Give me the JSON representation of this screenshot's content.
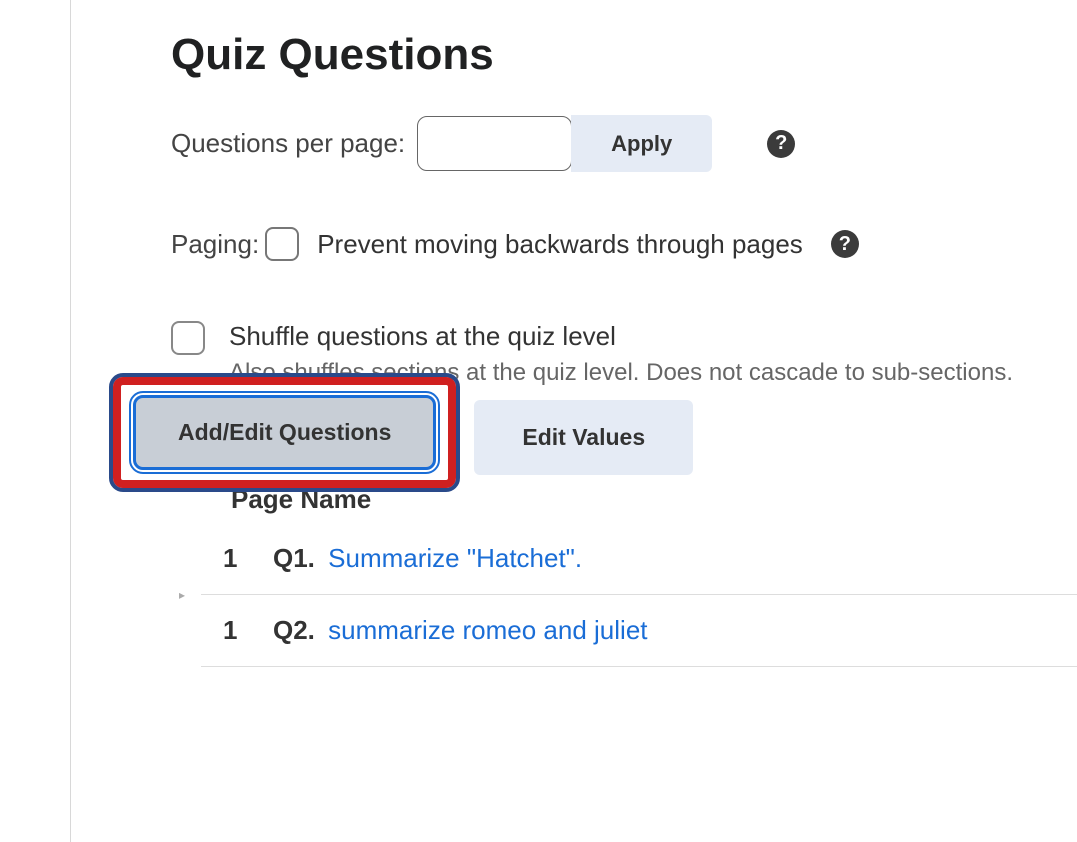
{
  "title": "Quiz Questions",
  "questions_per_page": {
    "label": "Questions per page:",
    "value": "",
    "apply_label": "Apply"
  },
  "paging": {
    "label": "Paging:",
    "text": "Prevent moving backwards through pages"
  },
  "shuffle": {
    "text": "Shuffle questions at the quiz level",
    "desc": "Also shuffles sections at the quiz level. Does not cascade to sub-sections."
  },
  "buttons": {
    "add_edit": "Add/Edit Questions",
    "edit_values": "Edit Values"
  },
  "table": {
    "header": "Page Name",
    "rows": [
      {
        "page": "1",
        "prefix": "Q1.",
        "link": "Summarize \"Hatchet\"."
      },
      {
        "page": "1",
        "prefix": "Q2.",
        "link": "summarize romeo and juliet"
      }
    ]
  }
}
